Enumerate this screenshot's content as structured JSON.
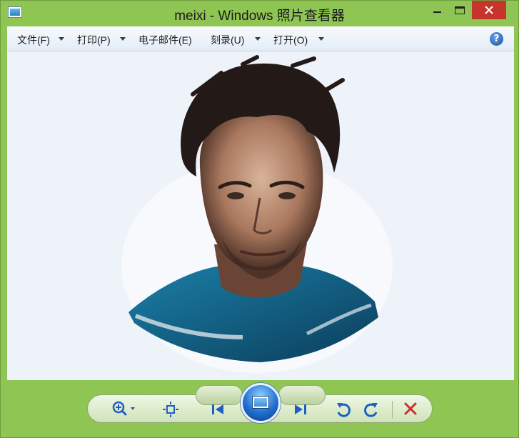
{
  "window": {
    "title": "meixi - Windows 照片查看器",
    "controls": [
      "minimize-icon",
      "maximize-icon",
      "close-icon"
    ]
  },
  "menubar": {
    "items": [
      {
        "label": "文件(F)",
        "has_dropdown": true
      },
      {
        "label": "打印(P)",
        "has_dropdown": true
      },
      {
        "label": "电子邮件(E)",
        "has_dropdown": false
      },
      {
        "label": "刻录(U)",
        "has_dropdown": true
      },
      {
        "label": "打开(O)",
        "has_dropdown": true
      }
    ],
    "help_glyph": "?"
  },
  "viewer": {
    "image_description_icon": "portrait-photo"
  },
  "toolbar": {
    "buttons": [
      "zoom-icon",
      "actual-size-icon",
      "previous-icon",
      "slideshow-icon",
      "next-icon",
      "rotate-counterclockwise-icon",
      "rotate-clockwise-icon",
      "delete-icon"
    ]
  },
  "colors": {
    "frame": "#8fc653",
    "close_button": "#c7342b",
    "viewer_background": "#eef3fa",
    "toolbar_blue": "#1f5fc4",
    "delete_red": "#d42b2b"
  }
}
